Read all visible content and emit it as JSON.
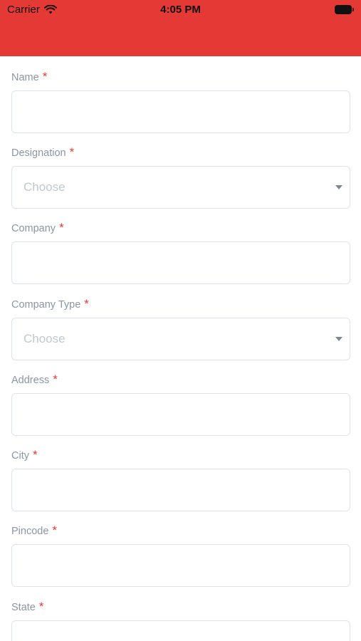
{
  "status_bar": {
    "carrier": "Carrier",
    "time": "4:05 PM"
  },
  "header": {
    "color": "#e53935"
  },
  "form": {
    "required_mark": "*",
    "fields": [
      {
        "label": "Name",
        "type": "text",
        "value": ""
      },
      {
        "label": "Designation",
        "type": "select",
        "value": "Choose"
      },
      {
        "label": "Company",
        "type": "text",
        "value": ""
      },
      {
        "label": "Company Type",
        "type": "select",
        "value": "Choose"
      },
      {
        "label": "Address",
        "type": "text",
        "value": ""
      },
      {
        "label": "City",
        "type": "text",
        "value": ""
      },
      {
        "label": "Pincode",
        "type": "text",
        "value": ""
      },
      {
        "label": "State",
        "type": "text",
        "value": ""
      }
    ]
  }
}
